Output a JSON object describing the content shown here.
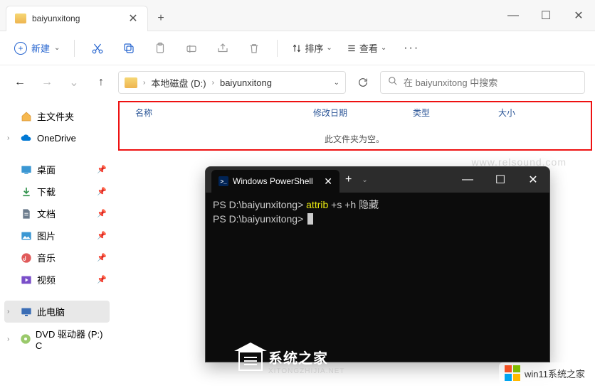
{
  "tab": {
    "title": "baiyunxitong"
  },
  "window_controls": {
    "min": "—",
    "max": "☐",
    "close": "✕"
  },
  "toolbar": {
    "new_label": "新建",
    "sort_label": "排序",
    "view_label": "查看"
  },
  "address": {
    "crumb1": "本地磁盘 (D:)",
    "crumb2": "baiyunxitong"
  },
  "search": {
    "placeholder": "在 baiyunxitong 中搜索"
  },
  "sidebar": {
    "home": "主文件夹",
    "onedrive": "OneDrive",
    "quick": [
      {
        "label": "桌面"
      },
      {
        "label": "下载"
      },
      {
        "label": "文档"
      },
      {
        "label": "图片"
      },
      {
        "label": "音乐"
      },
      {
        "label": "视频"
      }
    ],
    "thispc": "此电脑",
    "dvd": "DVD 驱动器 (P:) C"
  },
  "columns": {
    "name": "名称",
    "date": "修改日期",
    "type": "类型",
    "size": "大小"
  },
  "empty_msg": "此文件夹为空。",
  "powershell": {
    "title": "Windows PowerShell",
    "line1_prompt": "PS D:\\baiyunxitong>",
    "line1_cmd": "attrib",
    "line1_args": "+s +h 隐藏",
    "line2_prompt": "PS D:\\baiyunxitong>"
  },
  "watermark1": {
    "big": "系统之家",
    "small": "XITONGZHIJIA.NET"
  },
  "watermark2": "win11系统之家",
  "watermark3": "www.relsound.com"
}
